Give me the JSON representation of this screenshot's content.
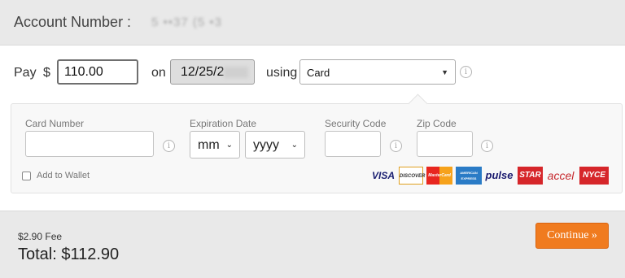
{
  "header": {
    "account_label": "Account Number :",
    "account_value": "5 ••37 (5  •3"
  },
  "pay": {
    "pay_label": "Pay",
    "currency": "$",
    "amount_value": "110.00",
    "on_label": "on",
    "date_value": "12/25/2",
    "using_label": "using",
    "method_value": "Card"
  },
  "card": {
    "card_number_label": "Card Number",
    "expiration_label": "Expiration Date",
    "month_value": "mm",
    "year_value": "yyyy",
    "security_label": "Security Code",
    "zip_label": "Zip Code",
    "add_wallet_label": "Add to Wallet"
  },
  "logos": [
    "VISA",
    "DISCOVER",
    "MasterCard",
    "AMERICAN EXPRESS",
    "pulse",
    "STAR",
    "accel",
    "NYCE"
  ],
  "footer": {
    "fee": "$2.90 Fee",
    "total": "Total: $112.90",
    "continue_label": "Continue »"
  },
  "colors": {
    "accent": "#f07b1f",
    "header_bg": "#e9e9e9",
    "panel_bg": "#f8f8f8"
  }
}
